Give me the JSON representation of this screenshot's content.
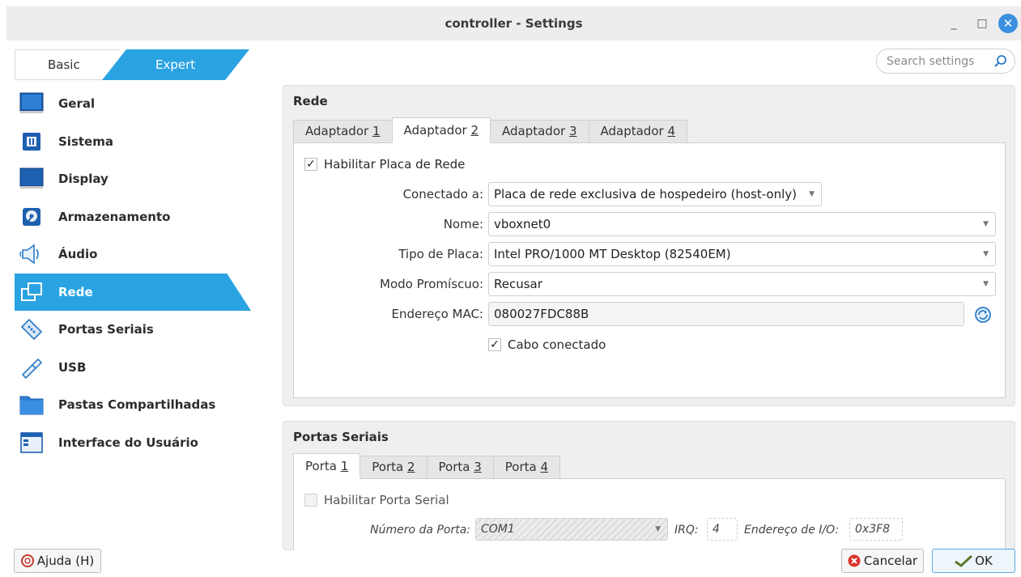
{
  "window": {
    "title": "controller - Settings",
    "minimize": "_",
    "maximize": "□",
    "close": "✕"
  },
  "mode": {
    "basic": "Basic",
    "expert": "Expert"
  },
  "search": {
    "placeholder": "Search settings"
  },
  "sidebar": {
    "items": [
      {
        "label": "Geral",
        "icon": "general-icon"
      },
      {
        "label": "Sistema",
        "icon": "system-chip-icon"
      },
      {
        "label": "Display",
        "icon": "display-monitor-icon"
      },
      {
        "label": "Armazenamento",
        "icon": "storage-disk-icon"
      },
      {
        "label": "Áudio",
        "icon": "speaker-icon"
      },
      {
        "label": "Rede",
        "icon": "network-icon",
        "active": true
      },
      {
        "label": "Portas Seriais",
        "icon": "serial-port-icon"
      },
      {
        "label": "USB",
        "icon": "usb-icon"
      },
      {
        "label": "Pastas Compartilhadas",
        "icon": "shared-folder-icon"
      },
      {
        "label": "Interface do Usuário",
        "icon": "user-interface-icon"
      }
    ]
  },
  "network": {
    "title": "Rede",
    "tabs": [
      {
        "pre": "Adaptador ",
        "key": "1"
      },
      {
        "pre": "Adaptador ",
        "key": "2"
      },
      {
        "pre": "Adaptador ",
        "key": "3"
      },
      {
        "pre": "Adaptador ",
        "key": "4"
      }
    ],
    "enable_label": "Habilitar Placa de Rede",
    "attached_label": "Conectado a:",
    "attached_value": "Placa de rede exclusiva de hospedeiro (host-only)",
    "name_label": "Nome:",
    "name_value": "vboxnet0",
    "type_label": "Tipo de Placa:",
    "type_value": "Intel PRO/1000 MT Desktop (82540EM)",
    "promisc_label": "Modo Promíscuo:",
    "promisc_value": "Recusar",
    "mac_label": "Endereço MAC:",
    "mac_value": "080027FDC88B",
    "cable_label": "Cabo conectado",
    "enabled": true,
    "cable_connected": true
  },
  "serial": {
    "title": "Portas Seriais",
    "tabs": [
      {
        "pre": "Porta ",
        "key": "1"
      },
      {
        "pre": "Porta ",
        "key": "2"
      },
      {
        "pre": "Porta ",
        "key": "3"
      },
      {
        "pre": "Porta ",
        "key": "4"
      }
    ],
    "enable_label": "Habilitar Porta Serial",
    "port_number_label": "Número da Porta:",
    "port_number_value": "COM1",
    "irq_label": "IRQ:",
    "irq_value": "4",
    "io_label": "Endereço de I/O:",
    "io_value": "0x3F8",
    "enabled": false
  },
  "buttons": {
    "help": "Ajuda (H)",
    "cancel": "Cancelar",
    "ok": "OK"
  },
  "colors": {
    "accent": "#2aa3e2",
    "close": "#3d8fe0"
  }
}
